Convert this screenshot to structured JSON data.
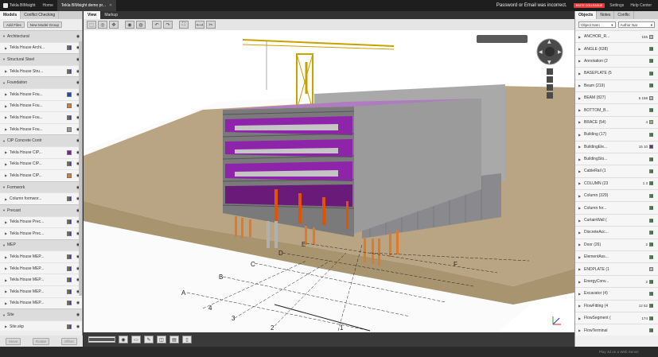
{
  "top": {
    "brand": "Tekla BIMsight",
    "nav": [
      {
        "label": "Home",
        "active": false
      },
      {
        "label": "Tekla BIMsight demo pr...",
        "active": true
      }
    ],
    "warning": "Password or Email was incorrect.",
    "badge": "INVITE COLLEAGUE",
    "settings": "Settings",
    "help": "Help Center"
  },
  "left": {
    "tabs": [
      "Models",
      "Conflict Checking"
    ],
    "add_files": "Add Files",
    "new_group": "New Model Group",
    "groups": [
      {
        "label": "Architectural",
        "rows": [
          {
            "label": "Tekla House Archi...",
            "swatch": "multi"
          }
        ]
      },
      {
        "label": "Structural Steel",
        "rows": [
          {
            "label": "Tekla House Stru...",
            "swatch": "multi"
          }
        ]
      },
      {
        "label": "Foundation",
        "rows": [
          {
            "label": "Tekla House Fou...",
            "swatch": "#2444c8"
          },
          {
            "label": "Tekla House Fou...",
            "swatch": "#e07a2a"
          },
          {
            "label": "Tekla House Fou...",
            "swatch": "multi"
          },
          {
            "label": "Tekla House Fou...",
            "swatch": "#999999"
          }
        ]
      },
      {
        "label": "CIP Concrete Contr",
        "rows": [
          {
            "label": "Tekla House CIP...",
            "swatch": "#7b1fa2"
          },
          {
            "label": "Tekla House CIP...",
            "swatch": "multi"
          },
          {
            "label": "Tekla House CIP...",
            "swatch": "#e07a2a"
          }
        ]
      },
      {
        "label": "Formwork",
        "rows": [
          {
            "label": "Column formwor...",
            "swatch": "multi"
          }
        ]
      },
      {
        "label": "Precast",
        "rows": [
          {
            "label": "Tekla House Prec...",
            "swatch": "multi"
          },
          {
            "label": "Tekla House Prec...",
            "swatch": "multi"
          }
        ]
      },
      {
        "label": "MEP",
        "rows": [
          {
            "label": "Tekla House MEP...",
            "swatch": "multi"
          },
          {
            "label": "Tekla House MEP...",
            "swatch": "multi"
          },
          {
            "label": "Tekla House MEP...",
            "swatch": "multi"
          },
          {
            "label": "Tekla House MEP...",
            "swatch": "multi"
          },
          {
            "label": "Tekla House MEP...",
            "swatch": "multi"
          }
        ]
      },
      {
        "label": "Site",
        "rows": [
          {
            "label": "Site.skp",
            "swatch": "multi"
          }
        ]
      }
    ],
    "bottom_buttons": [
      "Move",
      "Rotate",
      "Offset"
    ]
  },
  "view": {
    "tabs": [
      "View",
      "Markup"
    ],
    "grid_letters": [
      "A",
      "B",
      "C",
      "D",
      "E",
      "F"
    ],
    "grid_numbers": [
      "1",
      "2",
      "3",
      "4"
    ]
  },
  "right": {
    "tabs": [
      "Objects",
      "Notes",
      "Conflic"
    ],
    "filter1": "Object Nam",
    "filter2": "Author Nar",
    "objects": [
      {
        "label": "ANCHOR_R...",
        "count": "155",
        "swatch": "grey"
      },
      {
        "label": "ANGLE (638)",
        "count": "",
        "swatch": "multi"
      },
      {
        "label": "Annotation (2",
        "count": "",
        "swatch": "multi"
      },
      {
        "label": "BASEPLATE (5",
        "count": "",
        "swatch": "multi"
      },
      {
        "label": "Beam (219)",
        "count": "",
        "swatch": "multi"
      },
      {
        "label": "BEAM (827)",
        "count": "6  158",
        "swatch": "grey"
      },
      {
        "label": "BOTTOM_B...",
        "count": "",
        "swatch": "multi"
      },
      {
        "label": "BRACE (54)",
        "count": "4",
        "swatch": "#7ec850"
      },
      {
        "label": "Building (17)",
        "count": "",
        "swatch": "multi"
      },
      {
        "label": "BuildingEle...",
        "count": "15  10",
        "swatch": "#7b1fa2"
      },
      {
        "label": "BuildingSto...",
        "count": "",
        "swatch": "multi"
      },
      {
        "label": "CableRail (1",
        "count": "",
        "swatch": "multi"
      },
      {
        "label": "COLUMN (23",
        "count": "1  3",
        "swatch": "multi"
      },
      {
        "label": "Column (329)",
        "count": "",
        "swatch": "multi"
      },
      {
        "label": "Column for...",
        "count": "",
        "swatch": "multi"
      },
      {
        "label": "CurtainWall (",
        "count": "",
        "swatch": "multi"
      },
      {
        "label": "DiscreteAcc...",
        "count": "",
        "swatch": "multi"
      },
      {
        "label": "Door (26)",
        "count": "2",
        "swatch": "multi"
      },
      {
        "label": "ElementAss...",
        "count": "",
        "swatch": "multi"
      },
      {
        "label": "ENDPLATE (1",
        "count": "",
        "swatch": "grey"
      },
      {
        "label": "EnergyConv...",
        "count": "2",
        "swatch": "multi"
      },
      {
        "label": "Excavator (4)",
        "count": "",
        "swatch": "multi"
      },
      {
        "label": "FlowFitting (4",
        "count": "12  52",
        "swatch": "multi"
      },
      {
        "label": "FlowSegment (",
        "count": "174",
        "swatch": "multi"
      },
      {
        "label": "FlowTerminal",
        "count": "",
        "swatch": "multi"
      }
    ]
  },
  "status": "Play 3d on a Web Server"
}
